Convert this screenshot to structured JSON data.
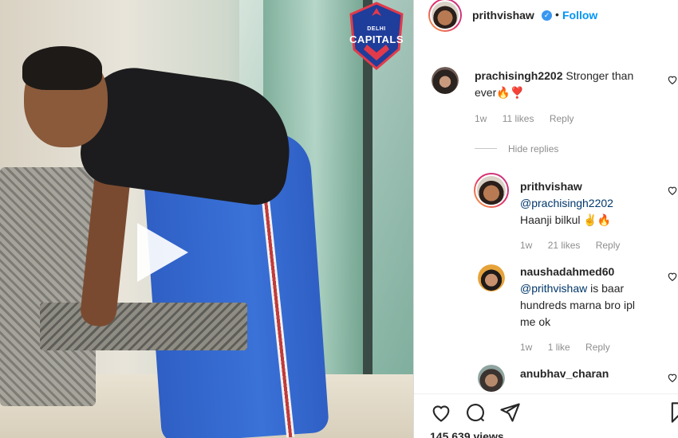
{
  "post": {
    "author": "prithvishaw",
    "follow_label": "Follow",
    "separator": "•",
    "views": "145,639 views"
  },
  "video": {
    "logo_line1": "DELHI",
    "logo_line2": "CAPITALS"
  },
  "comments": [
    {
      "username": "prachisingh2202",
      "text": "Stronger than ever🔥❣️",
      "time": "1w",
      "likes": "11 likes",
      "reply": "Reply"
    }
  ],
  "hide_replies": "Hide replies",
  "replies": [
    {
      "username": "prithvishaw",
      "mention": "@prachisingh2202",
      "text": "Haanji bilkul ✌️🔥",
      "time": "1w",
      "likes": "21 likes",
      "reply": "Reply"
    },
    {
      "username": "naushadahmed60",
      "mention": "@prithvishaw",
      "text": "is baar hundreds marna bro ipl me ok",
      "time": "1w",
      "likes": "1 like",
      "reply": "Reply"
    },
    {
      "username": "anubhav_charan"
    }
  ],
  "colors": {
    "accent": "#0095f6",
    "muted": "#8e8e8e",
    "text": "#262626"
  },
  "icons": [
    "heart-icon",
    "comment-icon",
    "share-icon",
    "bookmark-icon",
    "play-icon"
  ]
}
